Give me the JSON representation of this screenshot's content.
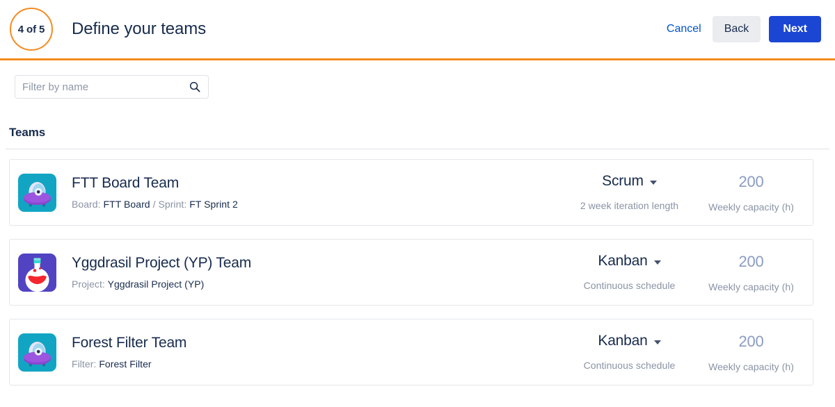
{
  "header": {
    "step_badge": "4 of 5",
    "title": "Define your teams",
    "cancel_label": "Cancel",
    "back_label": "Back",
    "next_label": "Next",
    "accent_color": "#F68B1E",
    "primary_color": "#1B46D4",
    "link_color": "#0052CC"
  },
  "filter": {
    "placeholder": "Filter by name",
    "value": "",
    "icon": "search-icon"
  },
  "section": {
    "heading": "Teams"
  },
  "teams": [
    {
      "name": "FTT Board Team",
      "avatar_icon": "ufo-avatar-icon",
      "avatar_bg": "#12A5C3",
      "meta": [
        {
          "label": "Board:",
          "value": "FTT Board"
        },
        {
          "separator": "/"
        },
        {
          "label": "Sprint:",
          "value": "FT Sprint 2"
        }
      ],
      "schedule": "Scrum",
      "schedule_label": "2 week iteration length",
      "capacity": "200",
      "capacity_label": "Weekly capacity (h)"
    },
    {
      "name": "Yggdrasil Project (YP) Team",
      "avatar_icon": "flask-avatar-icon",
      "avatar_bg": "#5243C2",
      "meta": [
        {
          "label": "Project:",
          "value": "Yggdrasil Project (YP)"
        }
      ],
      "schedule": "Kanban",
      "schedule_label": "Continuous schedule",
      "capacity": "200",
      "capacity_label": "Weekly capacity (h)"
    },
    {
      "name": "Forest Filter Team",
      "avatar_icon": "ufo-avatar-icon",
      "avatar_bg": "#12A5C3",
      "meta": [
        {
          "label": "Filter:",
          "value": "Forest Filter"
        }
      ],
      "schedule": "Kanban",
      "schedule_label": "Continuous schedule",
      "capacity": "200",
      "capacity_label": "Weekly capacity (h)"
    }
  ]
}
